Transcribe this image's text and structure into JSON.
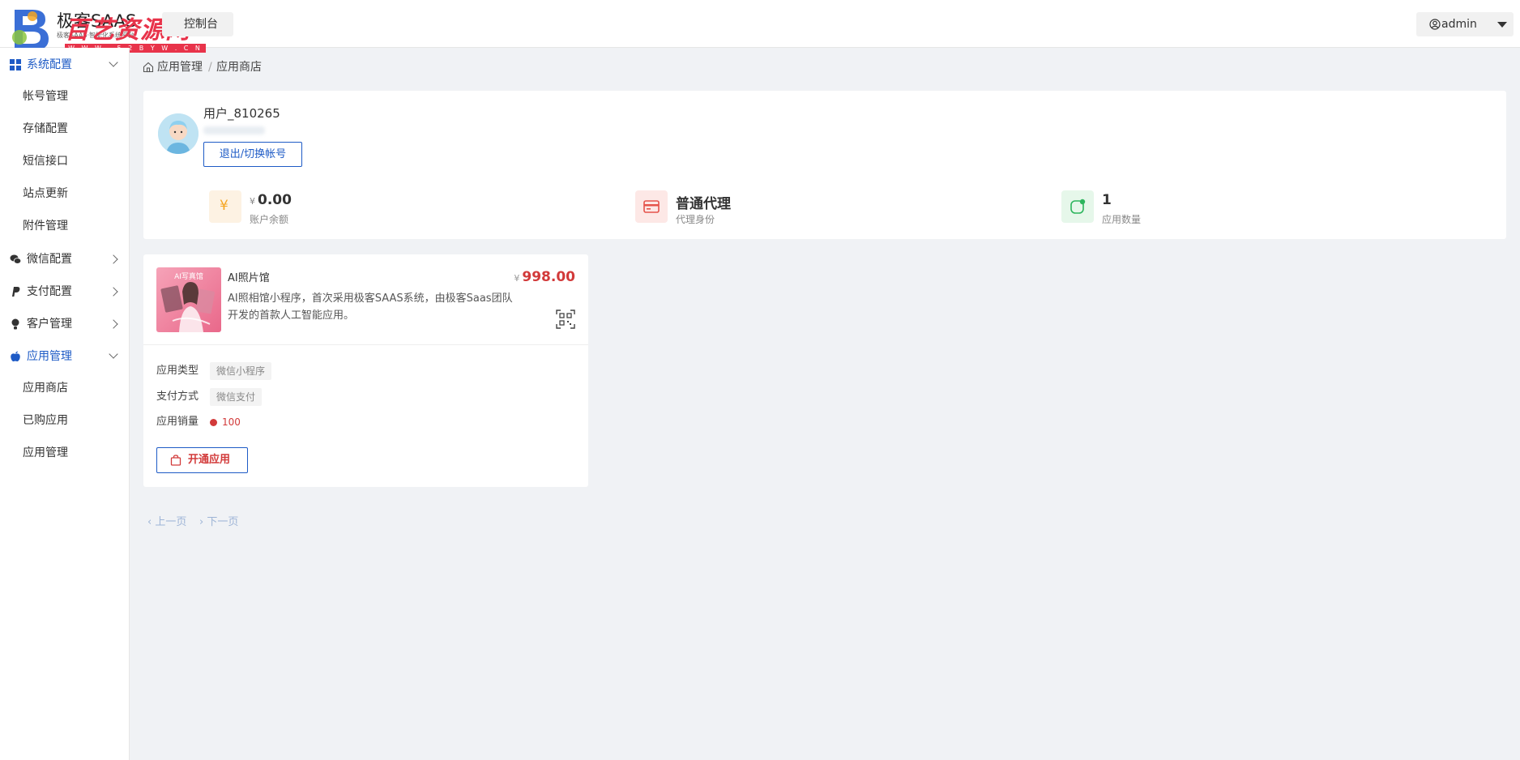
{
  "header": {
    "logo_title": "极客SAAS",
    "logo_sub": "极客SAAS·智能化系统平台",
    "watermark_text": "百艺资源网",
    "watermark_url": "W W W . 5 2 B Y W . C N",
    "console_label": "控制台",
    "user_label": "admin"
  },
  "sidebar": {
    "groups": [
      {
        "label": "系统配置",
        "icon": "grid-icon",
        "expanded": true,
        "items": [
          "帐号管理",
          "存储配置",
          "短信接口",
          "站点更新",
          "附件管理"
        ]
      },
      {
        "label": "微信配置",
        "icon": "wechat-icon",
        "expanded": false
      },
      {
        "label": "支付配置",
        "icon": "paypal-icon",
        "expanded": false
      },
      {
        "label": "客户管理",
        "icon": "user-icon",
        "expanded": false
      },
      {
        "label": "应用管理",
        "icon": "apple-icon",
        "expanded": true,
        "items": [
          "应用商店",
          "已购应用",
          "应用管理"
        ]
      }
    ]
  },
  "breadcrumb": {
    "parent": "应用管理",
    "separator": "/",
    "current": "应用商店"
  },
  "profile": {
    "username": "用户_810265",
    "logout_label": "退出/切换帐号",
    "stats": [
      {
        "currency": "¥",
        "value": "0.00",
        "caption": "账户余额",
        "icon": "yen-icon",
        "color": "#f5a623"
      },
      {
        "value": "普通代理",
        "caption": "代理身份",
        "icon": "card-icon",
        "color": "#e5534b"
      },
      {
        "value": "1",
        "caption": "应用数量",
        "icon": "app-count-icon",
        "color": "#2db55d"
      }
    ]
  },
  "app": {
    "name": "AI照片馆",
    "currency": "¥",
    "price": "998.00",
    "description": "AI照相馆小程序，首次采用极客SAAS系统，由极客Saas团队开发的首款人工智能应用。",
    "thumb_text": "AI写真馆",
    "type_label": "应用类型",
    "type_value": "微信小程序",
    "pay_label": "支付方式",
    "pay_value": "微信支付",
    "sales_label": "应用销量",
    "sales_value": "100",
    "open_label": "开通应用"
  },
  "pager": {
    "prev": "上一页",
    "next": "下一页"
  },
  "colors": {
    "accent": "#1e5bc6",
    "price": "#d23a3a",
    "background": "#f0f2f5"
  }
}
